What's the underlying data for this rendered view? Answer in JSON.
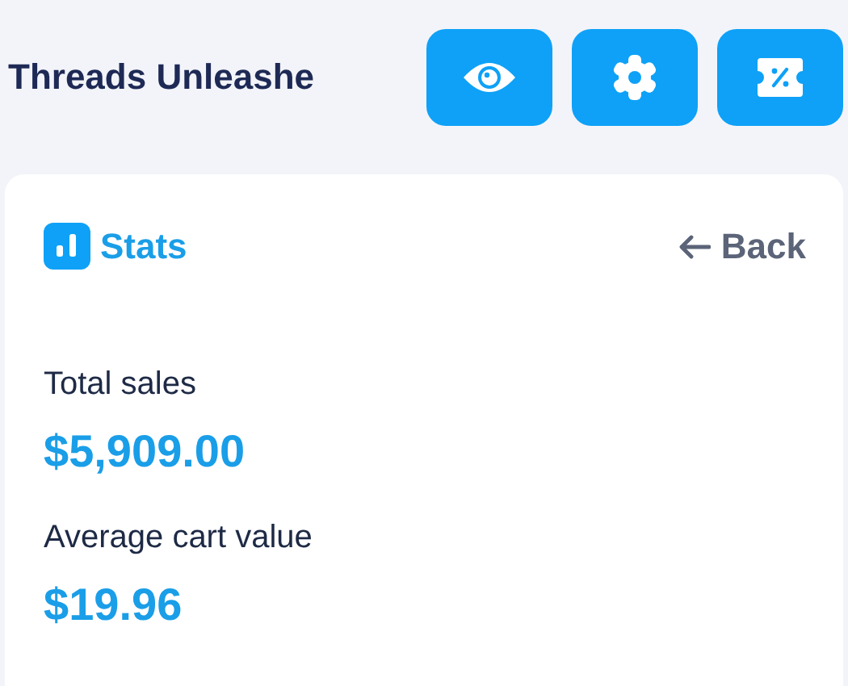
{
  "header": {
    "title": "Threads Unleashe",
    "buttons": [
      {
        "kind": "eye"
      },
      {
        "kind": "gear"
      },
      {
        "kind": "ticket"
      }
    ]
  },
  "card": {
    "title": "Stats",
    "back": "Back",
    "stats": [
      {
        "label": "Total sales",
        "value": "$5,909.00"
      },
      {
        "label": "Average cart value",
        "value": "$19.96"
      }
    ]
  }
}
